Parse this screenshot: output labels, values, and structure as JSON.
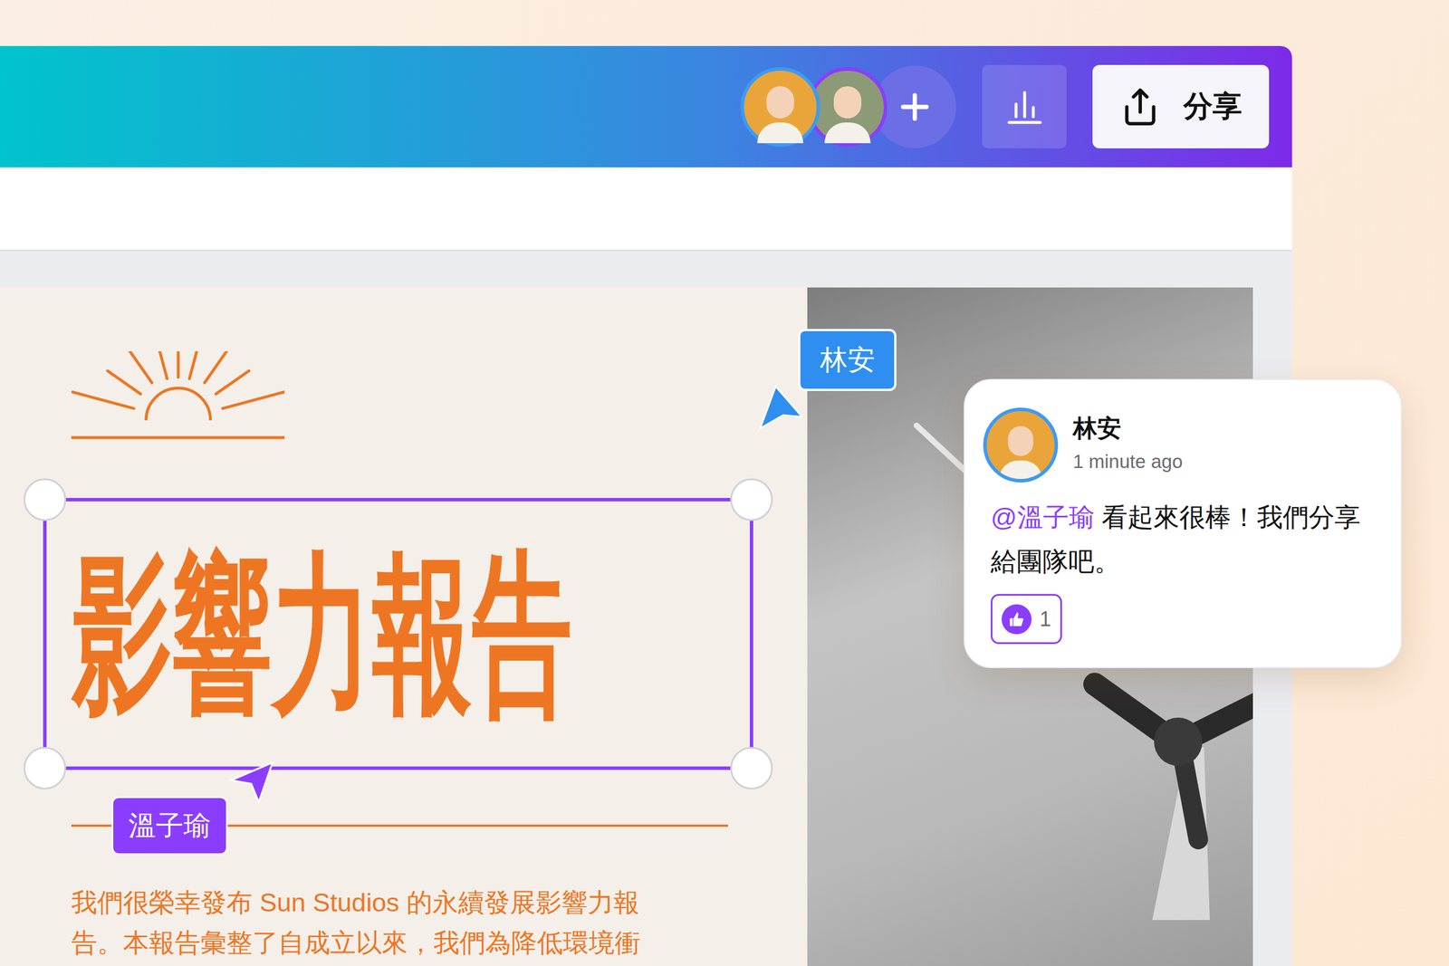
{
  "header": {
    "avatars": [
      {
        "ring": "#3b9bf5",
        "color": "#eaa53a"
      },
      {
        "ring": "#8b3dff",
        "color": "#8c9a78"
      }
    ],
    "share_button": {
      "label": "分享"
    }
  },
  "design": {
    "title": "影響力報告",
    "title_selected": true,
    "body_lines": [
      "我們很榮幸發布 Sun Studios 的永續發展影響力報",
      "告。本報告彙整了自成立以來，我們為降低環境衝"
    ]
  },
  "cursors": [
    {
      "name": "林安",
      "color": "#2e8ff0"
    },
    {
      "name": "溫子瑜",
      "color": "#8b3dff"
    }
  ],
  "comment": {
    "author": "林安",
    "time": "1 minute ago",
    "mention": "@溫子瑜",
    "text": "看起來很棒！我們分享給團隊吧。",
    "likes": "1",
    "liked": true
  }
}
